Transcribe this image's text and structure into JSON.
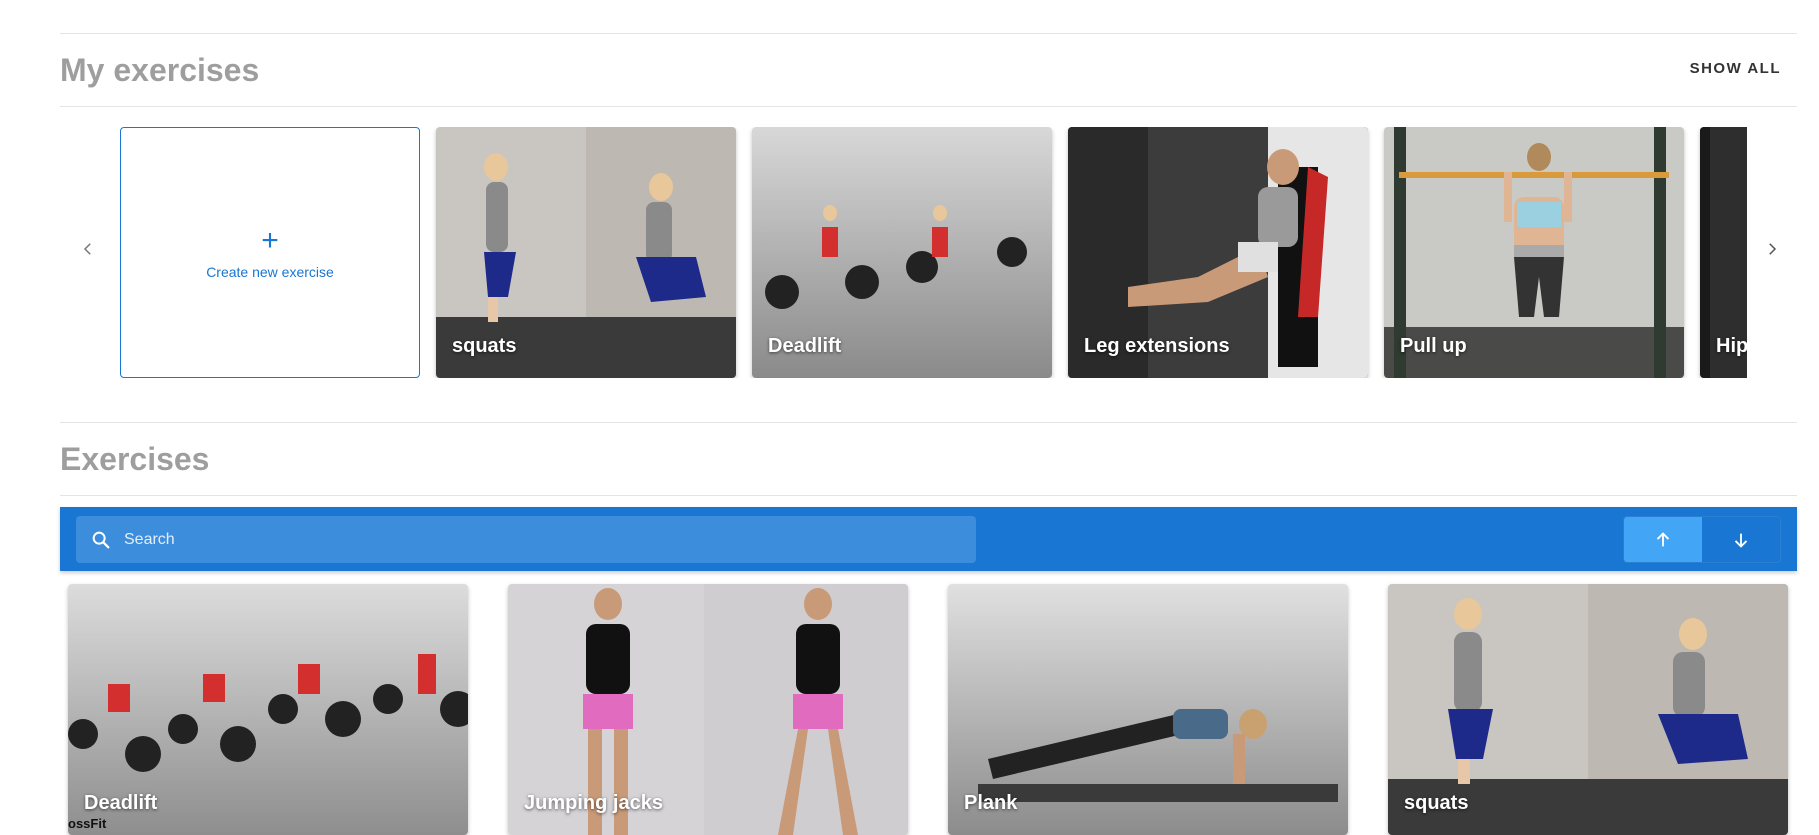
{
  "my_exercises": {
    "title": "My exercises",
    "show_all_label": "SHOW ALL",
    "create_label": "Create new exercise",
    "create_symbol": "+",
    "cards": [
      {
        "label": "squats"
      },
      {
        "label": "Deadlift"
      },
      {
        "label": "Leg extensions"
      },
      {
        "label": "Pull up"
      },
      {
        "label": "Hip"
      }
    ]
  },
  "exercises": {
    "title": "Exercises",
    "search": {
      "placeholder": "Search",
      "value": ""
    },
    "sort": {
      "asc_icon": "arrow-up-icon",
      "desc_icon": "arrow-down-icon"
    },
    "cards": [
      {
        "label": "Deadlift",
        "logo_text": "ossFit"
      },
      {
        "label": "Jumping jacks"
      },
      {
        "label": "Plank"
      },
      {
        "label": "squats"
      }
    ]
  },
  "colors": {
    "primary": "#1976d2",
    "toolbar_search": "#3d8ddd",
    "active_sort": "#42a5f5",
    "title_gray": "#9e9e9e"
  }
}
